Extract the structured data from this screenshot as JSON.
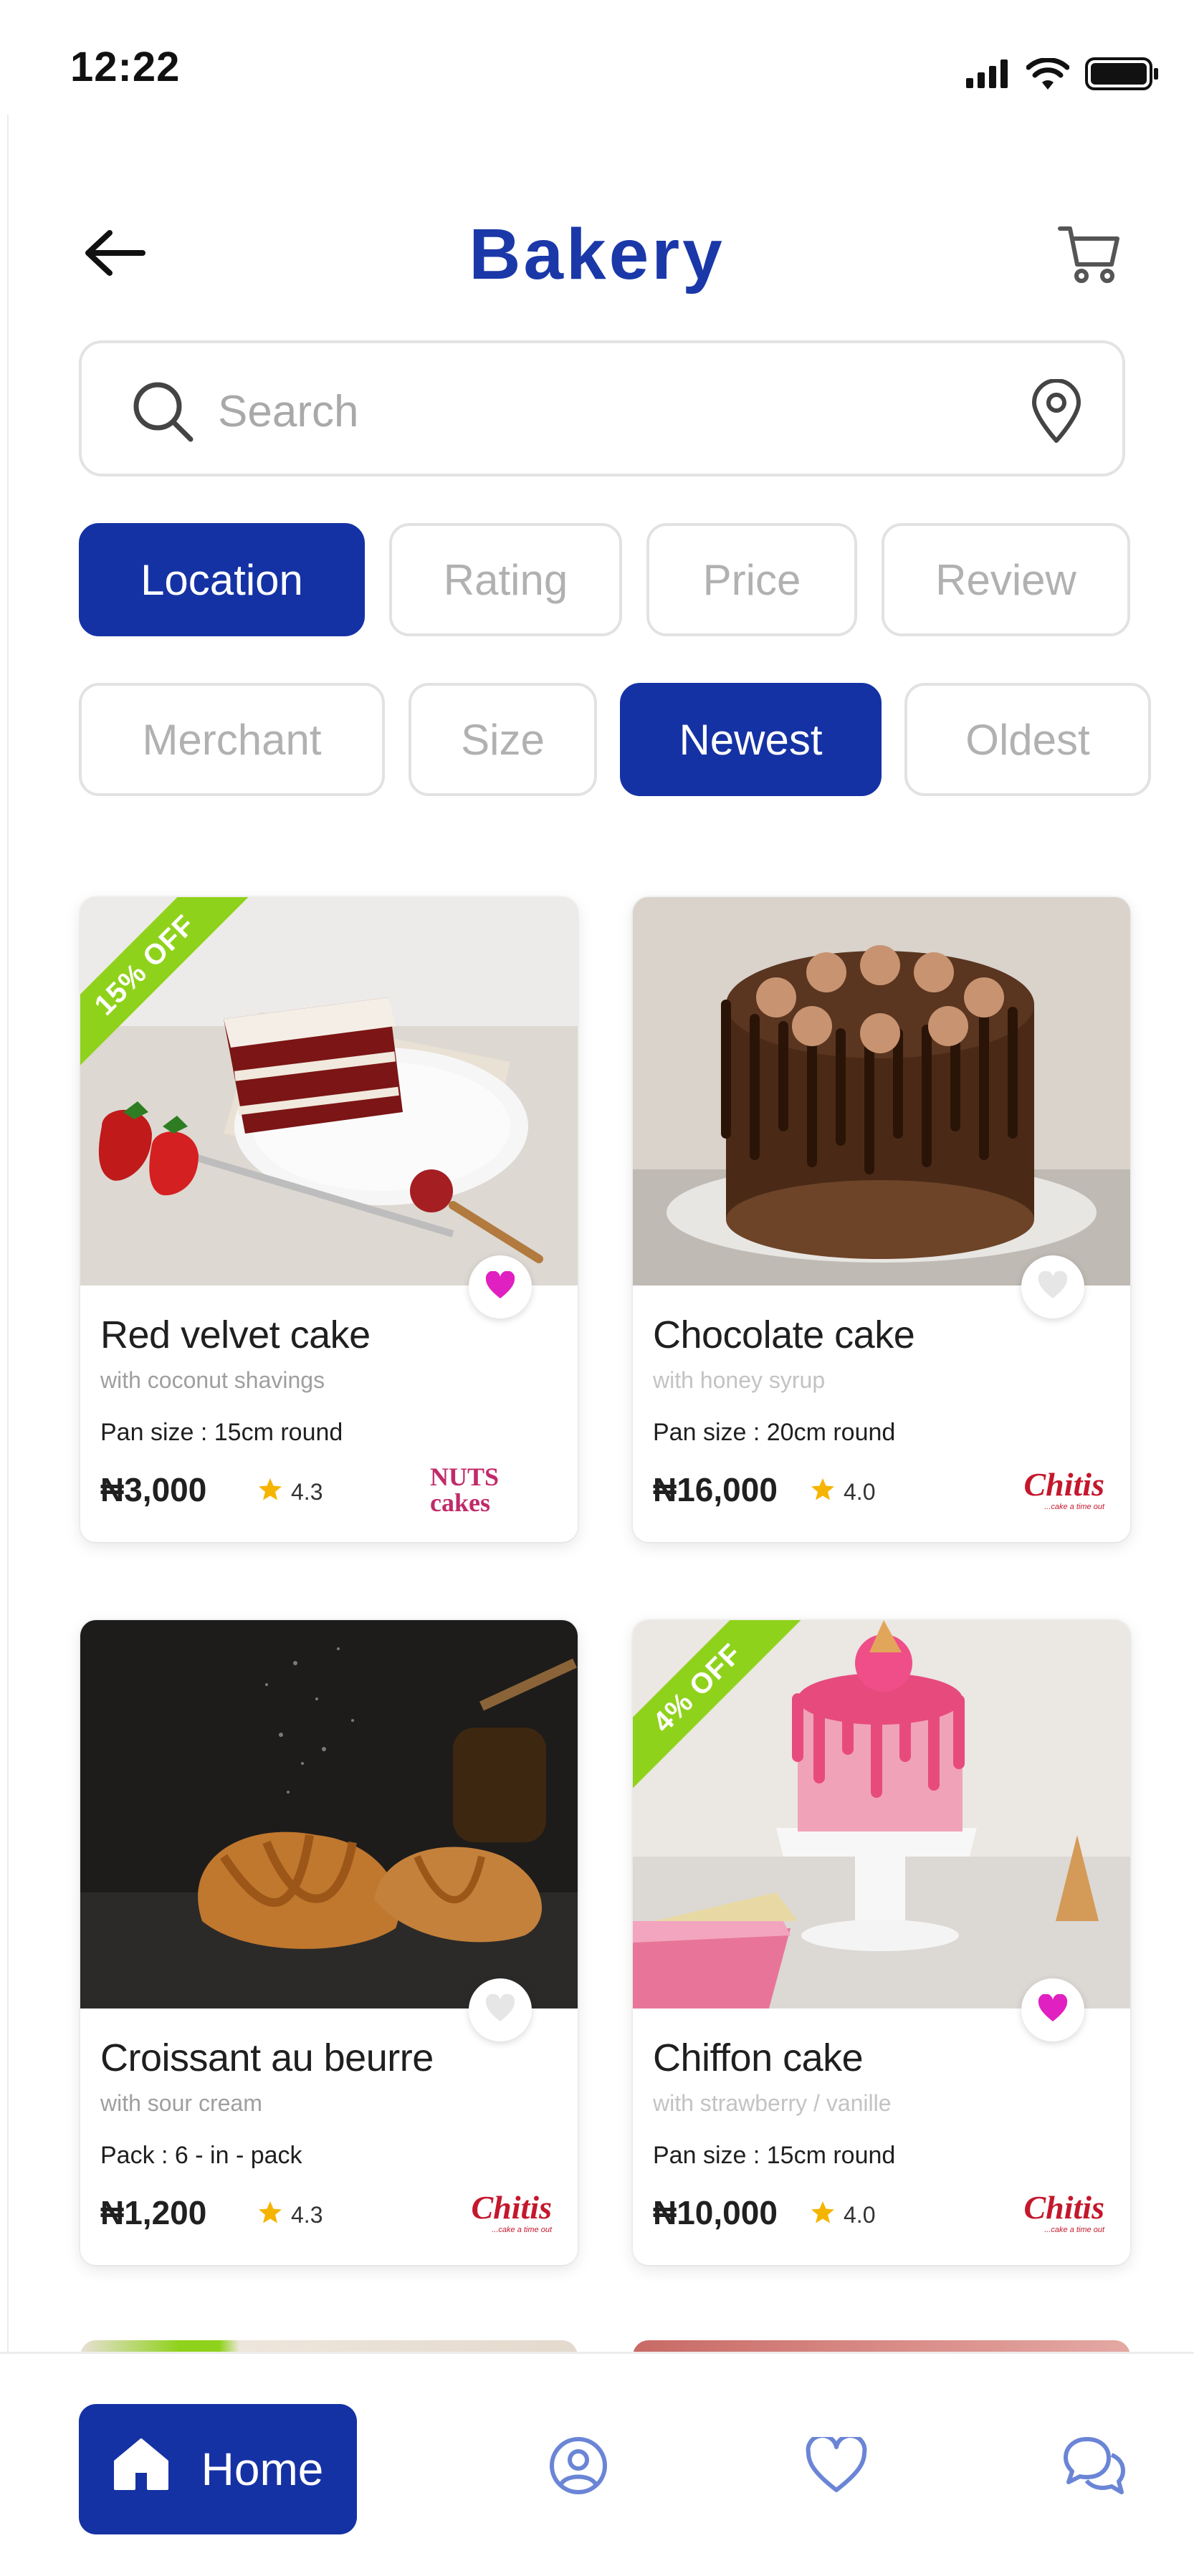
{
  "status_bar": {
    "time": "12:22"
  },
  "header": {
    "title": "Bakery",
    "back_icon": "arrow-left-icon",
    "cart_icon": "cart-icon"
  },
  "search": {
    "placeholder": "Search",
    "value": "",
    "icon": "search-icon",
    "location_icon": "location-pin-icon"
  },
  "filters": {
    "row1": [
      {
        "label": "Location",
        "active": true
      },
      {
        "label": "Rating",
        "active": false
      },
      {
        "label": "Price",
        "active": false
      },
      {
        "label": "Review",
        "active": false
      }
    ],
    "row2": [
      {
        "label": "Merchant",
        "active": false
      },
      {
        "label": "Size",
        "active": false
      },
      {
        "label": "Newest",
        "active": true
      },
      {
        "label": "Oldest",
        "active": false
      }
    ]
  },
  "products": [
    {
      "name": "Red velvet cake",
      "subtitle": "with coconut shavings",
      "detail": "Pan size : 15cm round",
      "price": "₦3,000",
      "rating": "4.3",
      "discount": "15% OFF",
      "favorite": true,
      "merchant": "NUTS cakes"
    },
    {
      "name": "Chocolate cake",
      "subtitle": "with honey syrup",
      "detail": "Pan size : 20cm round",
      "price": "₦16,000",
      "rating": "4.0",
      "discount": "",
      "favorite": false,
      "merchant": "Chitis"
    },
    {
      "name": "Croissant au beurre",
      "subtitle": "with sour cream",
      "detail": "Pack : 6 - in - pack",
      "price": "₦1,200",
      "rating": "4.3",
      "discount": "",
      "favorite": false,
      "merchant": "Chitis"
    },
    {
      "name": "Chiffon cake",
      "subtitle": "with strawberry / vanille",
      "detail": "Pan size : 15cm round",
      "price": "₦10,000",
      "rating": "4.0",
      "discount": "4% OFF",
      "favorite": true,
      "merchant": "Chitis"
    }
  ],
  "merchant_logos": {
    "chitis_tagline": "...cake a time out"
  },
  "bottom_nav": {
    "home_label": "Home",
    "items": [
      "home-icon",
      "profile-icon",
      "heart-icon",
      "chat-icon"
    ]
  },
  "colors": {
    "primary": "#1532a4",
    "title": "#1a38a8",
    "discount": "#8fd21b",
    "favorite": "#e020c0",
    "star": "#f5b400"
  }
}
